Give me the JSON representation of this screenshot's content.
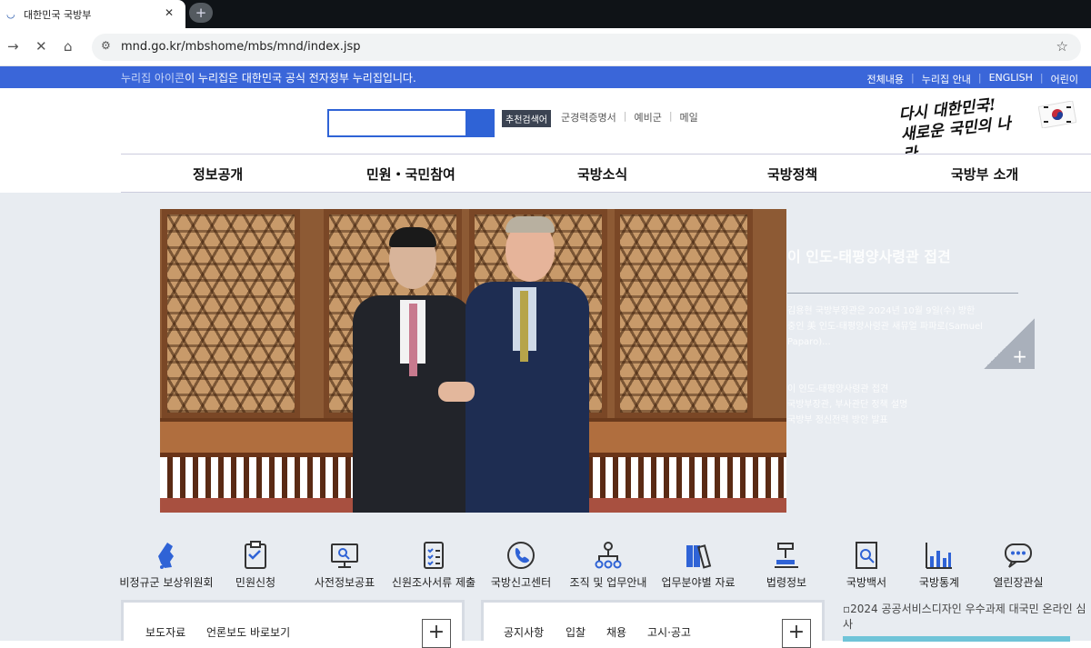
{
  "browser": {
    "tab_title": "대한민국 국방부",
    "new_tab": "+",
    "close": "✕",
    "url": "mnd.go.kr/mbshome/mbs/mnd/index.jsp"
  },
  "strip": {
    "nuri_alt": "누리집 아이콘",
    "nuri_text": "이 누리집은 대한민국 공식 전자정부 누리집입니다.",
    "links": [
      "전체내용",
      "누리집 안내",
      "ENGLISH",
      "어린이"
    ]
  },
  "header": {
    "recommend": "추천검색어",
    "quick_links": [
      "군경력증명서",
      "예비군",
      "메일"
    ],
    "slogan_line1": "다시 대한민국!",
    "slogan_line2": "새로운 국민의 나라"
  },
  "nav": [
    "정보공개",
    "민원・국민참여",
    "국방소식",
    "국방정책",
    "국방부 소개"
  ],
  "feature": {
    "title": "이 인도-태평양사령관 접견",
    "summary1": [
      "김용현 국방부장관은 2024년 10월 9일(수) 방한",
      "중인 美 인도-태평양사령관 새뮤얼 파파로(Samuel",
      "Paparo)..."
    ],
    "summary2": [
      "이 인도-태평양사령관 접견",
      "국방부장관, 부사관단 정책 설명",
      "국방부 정신전력 방안 발표"
    ]
  },
  "quickmenu": [
    {
      "label": "비정규군 보상위원회",
      "icon": "korea-map-icon"
    },
    {
      "label": "민원신청",
      "icon": "clipboard-icon"
    },
    {
      "label": "사전정보공표",
      "icon": "monitor-search-icon"
    },
    {
      "label": "신원조사서류 제출",
      "icon": "checklist-icon"
    },
    {
      "label": "국방신고센터",
      "icon": "phone-icon"
    },
    {
      "label": "조직 및 업무안내",
      "icon": "org-chart-icon"
    },
    {
      "label": "업무분야별 자료",
      "icon": "binders-icon"
    },
    {
      "label": "법령정보",
      "icon": "gavel-icon"
    },
    {
      "label": "국방백서",
      "icon": "book-search-icon"
    },
    {
      "label": "국방통계",
      "icon": "bar-chart-icon"
    },
    {
      "label": "열린장관실",
      "icon": "chat-icon"
    }
  ],
  "board1": {
    "tabs": [
      "보도자료",
      "언론보도 바로보기"
    ],
    "more": "+"
  },
  "board2": {
    "tabs": [
      "공지사항",
      "입찰",
      "채용",
      "고시·공고"
    ],
    "more": "+"
  },
  "banner_alt": "2024 공공서비스디자인 우수과제 대국민 온라인 심사"
}
